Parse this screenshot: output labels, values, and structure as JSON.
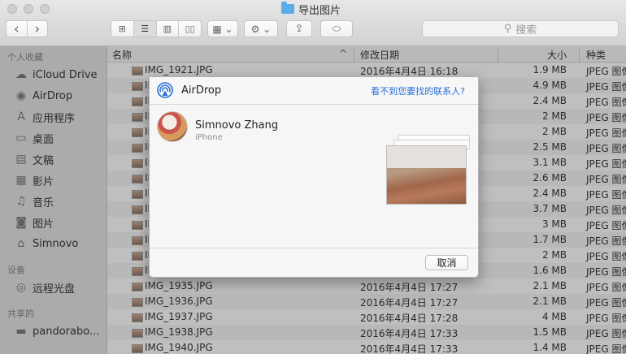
{
  "window": {
    "title": "导出图片"
  },
  "toolbar": {
    "back_glyph": "‹",
    "forward_glyph": "›",
    "view_icon_glyph": "⊞",
    "view_list_glyph": "☰",
    "view_column_glyph": "▥",
    "view_cover_glyph": "▯▯",
    "arrange_glyph": "▦ ⌄",
    "action_glyph": "⚙ ⌄",
    "share_glyph": "⇪",
    "tag_glyph": "⬭"
  },
  "search": {
    "placeholder": "搜索",
    "icon_glyph": "⚲"
  },
  "sidebar": {
    "favorites_label": "个人收藏",
    "devices_label": "设备",
    "shared_label": "共享的",
    "favorites": [
      {
        "label": "iCloud Drive",
        "icon": "cloud-icon",
        "glyph": "☁"
      },
      {
        "label": "AirDrop",
        "icon": "airdrop-icon",
        "glyph": "◉"
      },
      {
        "label": "应用程序",
        "icon": "applications-icon",
        "glyph": "A"
      },
      {
        "label": "桌面",
        "icon": "desktop-icon",
        "glyph": "▭"
      },
      {
        "label": "文稿",
        "icon": "documents-icon",
        "glyph": "▤"
      },
      {
        "label": "影片",
        "icon": "movies-icon",
        "glyph": "▦"
      },
      {
        "label": "音乐",
        "icon": "music-icon",
        "glyph": "♫"
      },
      {
        "label": "图片",
        "icon": "pictures-icon",
        "glyph": "◙"
      },
      {
        "label": "Simnovo",
        "icon": "home-icon",
        "glyph": "⌂"
      }
    ],
    "devices": [
      {
        "label": "远程光盘",
        "icon": "disc-icon",
        "glyph": "◎"
      }
    ],
    "shared": [
      {
        "label": "pandorabo...",
        "icon": "computer-icon",
        "glyph": "▬"
      }
    ]
  },
  "list": {
    "headers": {
      "name": "名称",
      "date": "修改日期",
      "size": "大小",
      "kind": "种类"
    },
    "sort_glyph": "^",
    "rows": [
      {
        "name": "IMG_1921.JPG",
        "date": "2016年4月4日 16:18",
        "size": "1.9 MB",
        "kind": "JPEG 图像"
      },
      {
        "name": "IMG",
        "date": "",
        "size": "4.9 MB",
        "kind": "JPEG 图像"
      },
      {
        "name": "IMG",
        "date": "",
        "size": "2.4 MB",
        "kind": "JPEG 图像"
      },
      {
        "name": "IMG",
        "date": "",
        "size": "2 MB",
        "kind": "JPEG 图像"
      },
      {
        "name": "IMG",
        "date": "",
        "size": "2 MB",
        "kind": "JPEG 图像"
      },
      {
        "name": "IMG",
        "date": "",
        "size": "2.5 MB",
        "kind": "JPEG 图像"
      },
      {
        "name": "IMG",
        "date": "",
        "size": "3.1 MB",
        "kind": "JPEG 图像"
      },
      {
        "name": "IMG",
        "date": "",
        "size": "2.6 MB",
        "kind": "JPEG 图像"
      },
      {
        "name": "IMG",
        "date": "",
        "size": "2.4 MB",
        "kind": "JPEG 图像"
      },
      {
        "name": "IMG",
        "date": "",
        "size": "3.7 MB",
        "kind": "JPEG 图像"
      },
      {
        "name": "IMG",
        "date": "",
        "size": "3 MB",
        "kind": "JPEG 图像"
      },
      {
        "name": "IMG",
        "date": "",
        "size": "1.7 MB",
        "kind": "JPEG 图像"
      },
      {
        "name": "IMG",
        "date": "",
        "size": "2 MB",
        "kind": "JPEG 图像"
      },
      {
        "name": "IMG",
        "date": "",
        "size": "1.6 MB",
        "kind": "JPEG 图像"
      },
      {
        "name": "IMG_1935.JPG",
        "date": "2016年4月4日 17:27",
        "size": "2.1 MB",
        "kind": "JPEG 图像"
      },
      {
        "name": "IMG_1936.JPG",
        "date": "2016年4月4日 17:27",
        "size": "2.1 MB",
        "kind": "JPEG 图像"
      },
      {
        "name": "IMG_1937.JPG",
        "date": "2016年4月4日 17:28",
        "size": "4 MB",
        "kind": "JPEG 图像"
      },
      {
        "name": "IMG_1938.JPG",
        "date": "2016年4月4日 17:33",
        "size": "1.5 MB",
        "kind": "JPEG 图像"
      },
      {
        "name": "IMG_1940.JPG",
        "date": "2016年4月4日 17:33",
        "size": "1.4 MB",
        "kind": "JPEG 图像"
      }
    ]
  },
  "airdrop": {
    "title": "AirDrop",
    "help_link": "看不到您要找的联系人?",
    "contact": {
      "name": "Simnovo Zhang",
      "device": "iPhone"
    },
    "cancel_label": "取消"
  },
  "colors": {
    "accent": "#2a6fd6",
    "folder": "#5aaee8"
  }
}
